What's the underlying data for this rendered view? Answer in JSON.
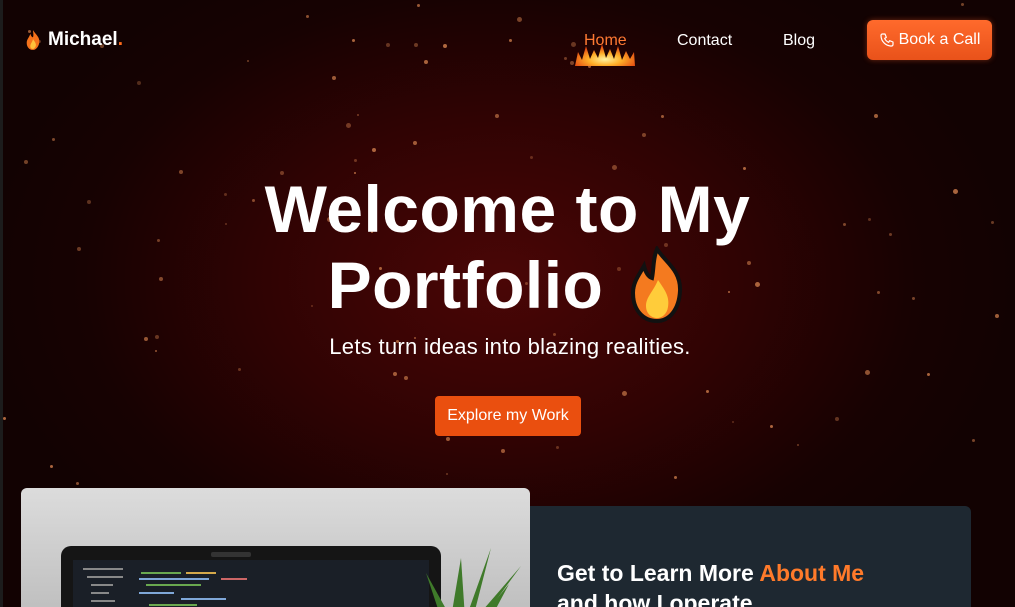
{
  "nav": {
    "logo_text": "Michael",
    "logo_dot": ".",
    "links": [
      {
        "label": "Home",
        "active": true
      },
      {
        "label": "Contact",
        "active": false
      },
      {
        "label": "Blog",
        "active": false
      }
    ],
    "cta_label": "Book a Call"
  },
  "hero": {
    "headline_line1": "Welcome to My",
    "headline_line2": "Portfolio",
    "tagline": "Lets turn ideas into blazing realities.",
    "button_label": "Explore my Work"
  },
  "about": {
    "title_prefix": "Get to Learn More ",
    "title_accent": "About Me",
    "title_line2": "and how I operate"
  },
  "colors": {
    "accent": "#ff6a1a",
    "button": "#ea4f0f",
    "card_bg": "#1e2831",
    "hero_glow": "#4a0606"
  },
  "icons": [
    "flame-icon",
    "phone-icon",
    "fire-underline-icon",
    "large-flame-icon"
  ]
}
